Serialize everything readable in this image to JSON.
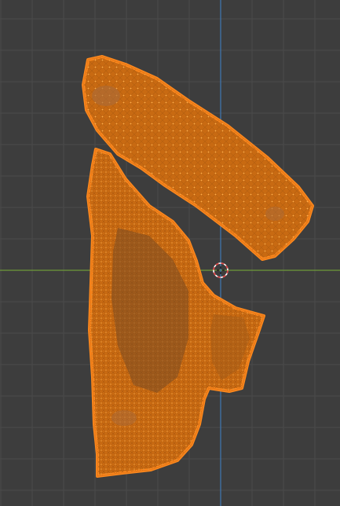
{
  "viewport": {
    "background": "#3d3d3d",
    "grid_minor_color": "#444444",
    "grid_major_color": "#4a4a4a",
    "x_axis_color": "#6e9a3a",
    "y_axis_color": "#3f78b4"
  },
  "mesh": {
    "selection_color": "#ff8a1e",
    "wire_color": "#e87a18",
    "face_fill": "#c86a12",
    "dark_face": "#6b4a2a",
    "select_mode": "vertex"
  },
  "cursor": {
    "icon": "3d-cursor-icon",
    "ring_red": "#e04040",
    "ring_white": "#ffffff"
  }
}
